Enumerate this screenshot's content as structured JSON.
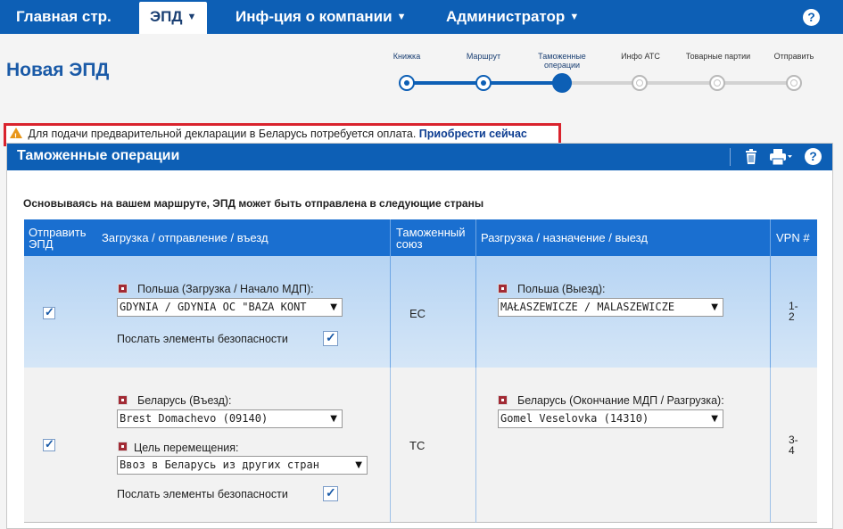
{
  "nav": {
    "home": "Главная стр.",
    "epd": "ЭПД",
    "company": "Инф-ция о компании",
    "admin": "Администратор",
    "help": "?"
  },
  "page": {
    "title": "Новая ЭПД"
  },
  "steps": {
    "s1": "Книжка",
    "s2": "Маршрут",
    "s3_line1": "Таможенные",
    "s3_line2": "операции",
    "s4": "Инфо АТС",
    "s5": "Товарные партии",
    "s6": "Отправить",
    "current_step": 3
  },
  "alert": {
    "text": "Для подачи предварительной декларации в Беларусь потребуется оплата.",
    "link": "Приобрести сейчас"
  },
  "panel": {
    "title": "Таможенные операции",
    "help": "?",
    "intro": "Основываясь на вашем маршруте, ЭПД может быть отправлена в следующие страны"
  },
  "table": {
    "h_send_1": "Отправить",
    "h_send_2": "ЭПД",
    "h_loading": "Загрузка / отправление / въезд",
    "h_union_1": "Таможенный",
    "h_union_2": "союз",
    "h_unloading": "Разгрузка / назначение / выезд",
    "h_vpn": "VPN #"
  },
  "row1": {
    "send_checked": true,
    "load_label": "Польша (Загрузка / Начало МДП):",
    "load_value": "GDYNIA / GDYNIA OC \"BAZA KONT",
    "security_label": "Послать элементы безопасности",
    "security_checked": true,
    "union": "ЕС",
    "unload_label": "Польша (Выезд):",
    "unload_value": "MAŁASZEWICZE / MALASZEWICZE",
    "vpn_1": "1-",
    "vpn_2": "2"
  },
  "row2": {
    "send_checked": true,
    "load_label": "Беларусь (Въезд):",
    "load_value": "Brest Domachevo (09140)",
    "purpose_label": "Цель перемещения:",
    "purpose_value": "Ввоз в Беларусь из других стран",
    "security_label": "Послать элементы безопасности",
    "security_checked": true,
    "union": "ТС",
    "unload_label": "Беларусь (Окончание МДП / Разгрузка):",
    "unload_value": "Gomel Veselovka (14310)",
    "vpn_1": "3-",
    "vpn_2": "4"
  },
  "colors": {
    "brand": "#0d5fb5",
    "alert_border": "#d9232d",
    "warning": "#e8961a"
  },
  "icons": [
    "warning-icon",
    "trash-icon",
    "print-icon",
    "help-icon",
    "flag-icon",
    "chevron-down-icon",
    "checkbox-icon"
  ]
}
